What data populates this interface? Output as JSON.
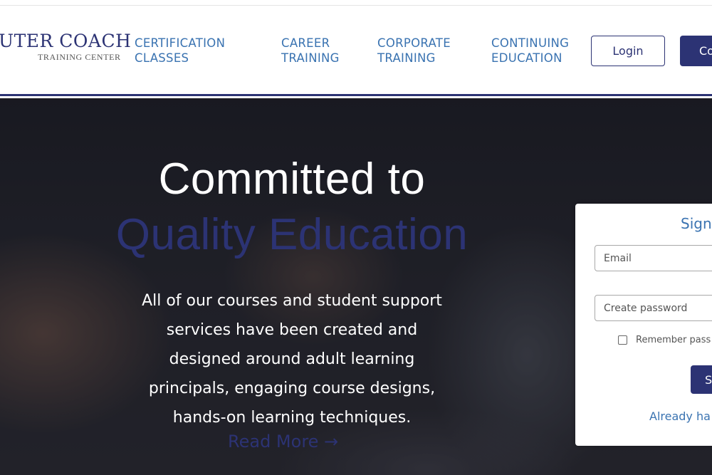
{
  "logo": {
    "main": "UTER COACH",
    "sub": "TRAINING CENTER"
  },
  "nav": {
    "items": [
      {
        "line1": "CERTIFICATION",
        "line2": "CLASSES"
      },
      {
        "line1": "CAREER",
        "line2": "TRAINING"
      },
      {
        "line1": "CORPORATE",
        "line2": "TRAINING"
      },
      {
        "line1": "CONTINUING",
        "line2": "EDUCATION"
      }
    ],
    "login_label": "Login",
    "create_label": "Co"
  },
  "hero": {
    "title_line1": "Committed to",
    "title_line2": "Quality Education",
    "body_lines": [
      "All of our courses and student support",
      "services have been created and",
      "designed around adult learning",
      "principals, engaging course designs,",
      "hands-on learning techniques."
    ],
    "read_more": "Read More →"
  },
  "signin": {
    "title": "Sign",
    "email_placeholder": "Email",
    "password_placeholder": "Create password",
    "remember_label": "Remember pass",
    "submit_label": "S",
    "already_link": "Already ha"
  },
  "colors": {
    "brand_navy": "#2c3374",
    "link_blue": "#3a73b1"
  }
}
